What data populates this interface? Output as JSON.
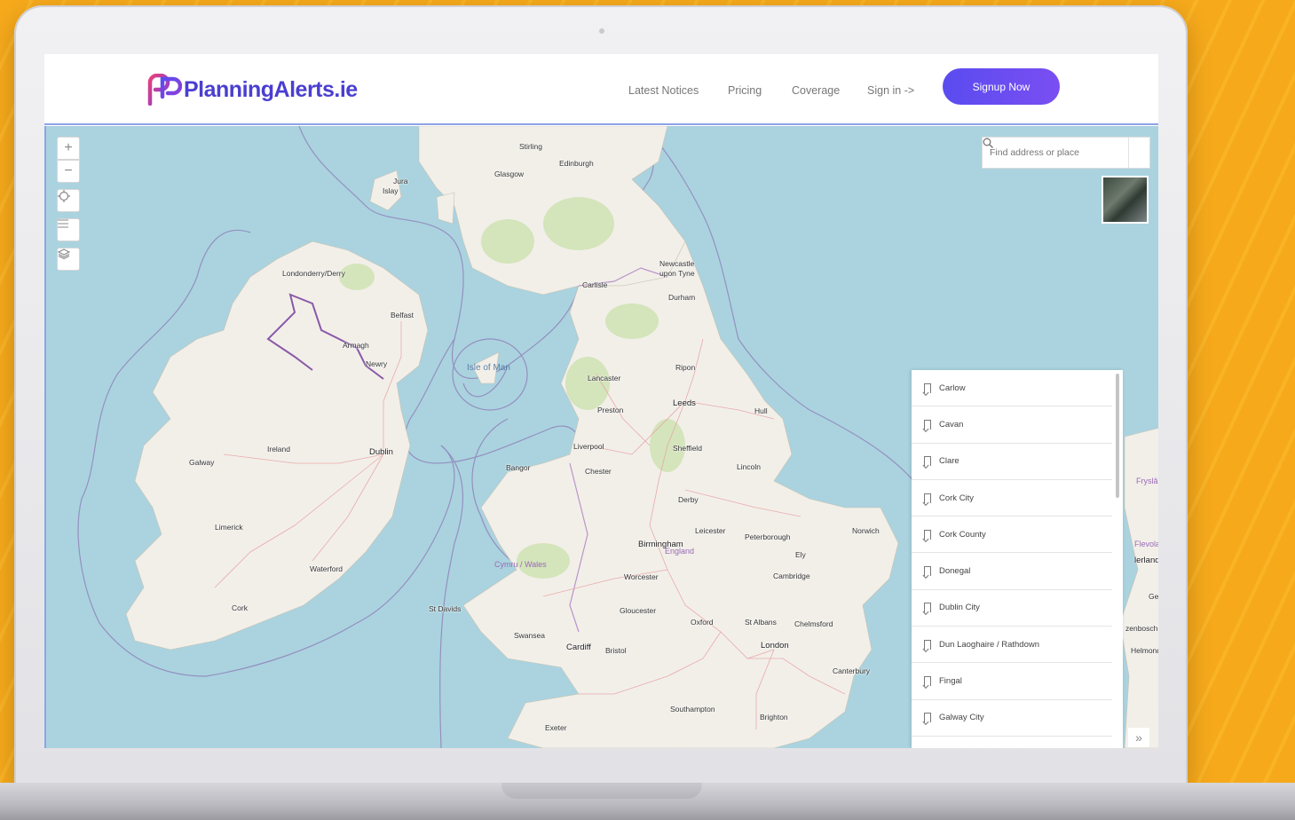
{
  "brand": {
    "name": "PlanningAlerts.ie",
    "color": "#4a3fd0"
  },
  "nav": {
    "items": [
      {
        "label": "Latest Notices"
      },
      {
        "label": "Pricing"
      },
      {
        "label": "Coverage"
      },
      {
        "label": "Sign in ->"
      }
    ],
    "signup_label": "Signup Now",
    "accent": "#5a4cf0"
  },
  "map": {
    "search_placeholder": "Find address or place",
    "controls": [
      "zoom-in-icon",
      "zoom-out-icon",
      "locate-icon",
      "list-icon",
      "layers-icon"
    ],
    "places": {
      "stirling": "Stirling",
      "edinburgh": "Edinburgh",
      "glasgow": "Glasgow",
      "jura": "Jura",
      "islay": "Islay",
      "londonderry": "Londonderry/Derry",
      "belfast": "Belfast",
      "armagh": "Armagh",
      "newry": "Newry",
      "newcastle1": "Newcastle",
      "newcastle2": "upon Tyne",
      "carlisle": "Carlisle",
      "durham": "Durham",
      "isle_of_man": "Isle of Man",
      "ripon": "Ripon",
      "lancaster": "Lancaster",
      "preston": "Preston",
      "leeds": "Leeds",
      "hull": "Hull",
      "liverpool": "Liverpool",
      "sheffield": "Sheffield",
      "bangor": "Bangor",
      "chester": "Chester",
      "lincoln": "Lincoln",
      "ireland": "Ireland",
      "dublin": "Dublin",
      "galway": "Galway",
      "derby": "Derby",
      "leicester": "Leicester",
      "peterborough": "Peterborough",
      "norwich": "Norwich",
      "birmingham": "Birmingham",
      "england": "England",
      "ely": "Ely",
      "limerick": "Limerick",
      "cymru": "Cymru / Wales",
      "worcester": "Worcester",
      "cambridge": "Cambridge",
      "waterford": "Waterford",
      "cork": "Cork",
      "gloucester": "Gloucester",
      "st_davids": "St Davids",
      "oxford": "Oxford",
      "st_albans": "St Albans",
      "chelmsford": "Chelmsford",
      "swansea": "Swansea",
      "cardiff": "Cardiff",
      "bristol": "Bristol",
      "london": "London",
      "canterbury": "Canterbury",
      "southampton": "Southampton",
      "brighton": "Brighton",
      "exeter": "Exeter",
      "frysla": "Fryslâ",
      "flevoland": "Flevoland",
      "nederland": "lerland",
      "gelderland": "Gel",
      "zenbosch": "zenbosch",
      "helmond": "Helmond"
    }
  },
  "councils": [
    "Carlow",
    "Cavan",
    "Clare",
    "Cork City",
    "Cork County",
    "Donegal",
    "Dublin City",
    "Dun Laoghaire / Rathdown",
    "Fingal",
    "Galway City"
  ],
  "colors": {
    "sea": "#aad3df",
    "land": "#f2efe9",
    "border": "#9b7fb5"
  }
}
